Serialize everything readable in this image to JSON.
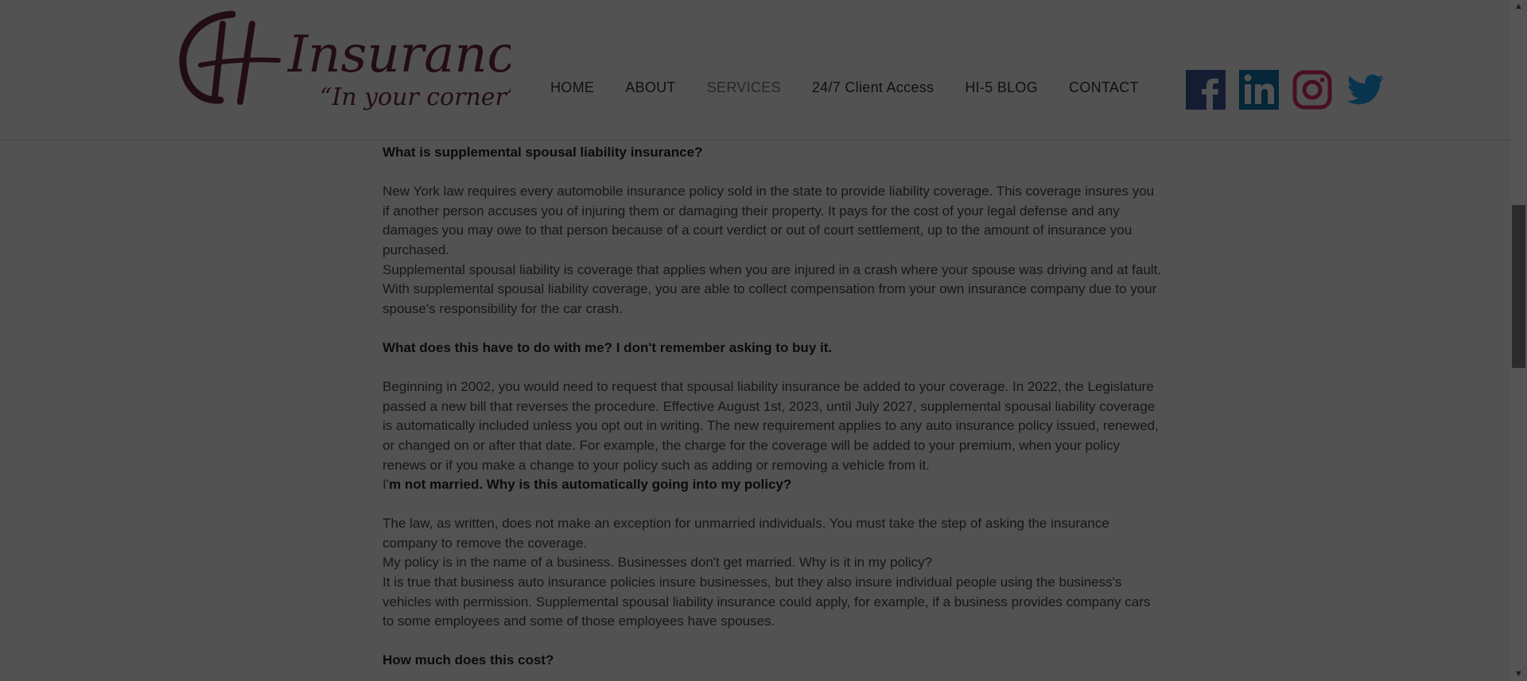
{
  "logo": {
    "monogram": "CH",
    "wordmark": "Insurance",
    "tagline": "“In your corner”"
  },
  "nav": [
    {
      "label": "HOME",
      "active": false
    },
    {
      "label": "ABOUT",
      "active": false
    },
    {
      "label": "SERVICES",
      "active": true
    },
    {
      "label": "24/7 Client Access",
      "active": false
    },
    {
      "label": "HI-5 BLOG",
      "active": false
    },
    {
      "label": "CONTACT",
      "active": false
    }
  ],
  "social": [
    {
      "name": "facebook-icon",
      "color": "#3b5998"
    },
    {
      "name": "linkedin-icon",
      "color": "#0e76a8"
    },
    {
      "name": "instagram-icon",
      "color": "#e1306c"
    },
    {
      "name": "twitter-icon",
      "color": "#1da1f2"
    }
  ],
  "content": {
    "q1": "What is supplemental spousal liability insurance?",
    "p1": "New York law requires every automobile insurance policy sold in the state to provide liability coverage. This coverage insures you if another person accuses you of injuring them or damaging their property. It pays for the cost of your legal defense and any damages you may owe to that person because of a court verdict or out of court settlement, up to the amount of insurance you purchased.",
    "p2": "Supplemental spousal liability is coverage that applies when you are injured in a crash where your spouse was driving and at fault. With supplemental spousal liability coverage, you are able to collect compensation from your own insurance company due to your spouse's responsibility for the car crash.",
    "q2": "What does this have to do with me? I don't remember asking to buy it.",
    "p3": "Beginning in 2002, you would need to request that spousal liability insurance be added to your coverage. In 2022, the Legislature passed a new bill that reverses the procedure. Effective August 1st, 2023, until July 2027, supplemental spousal liability coverage is automatically included unless you opt out in writing. The new requirement applies to any auto insurance policy issued, renewed, or changed on or after that date. For example, the charge for the coverage will be added to your premium, when your policy renews or if you make a change to your policy such as adding or removing a vehicle from it.",
    "q3_prefix": "I'",
    "q3_rest": "m not married. Why is this automatically going into my policy?",
    "p4": "The law, as written, does not make an exception for unmarried individuals. You must take the step of asking the insurance company to remove the coverage.",
    "p5": "My policy is in the name of a business. Businesses don't get married. Why is it in my policy?",
    "p6": "It is true that business auto insurance policies insure businesses, but they also insure individual people using the business's vehicles with permission. Supplemental spousal liability insurance could apply, for example, if a business provides company cars to some employees and some of those employees have spouses.",
    "q4": "How much does this cost?"
  },
  "colors": {
    "logo": "#6b2a3a",
    "overlay": "rgba(0,0,0,0.68)"
  }
}
